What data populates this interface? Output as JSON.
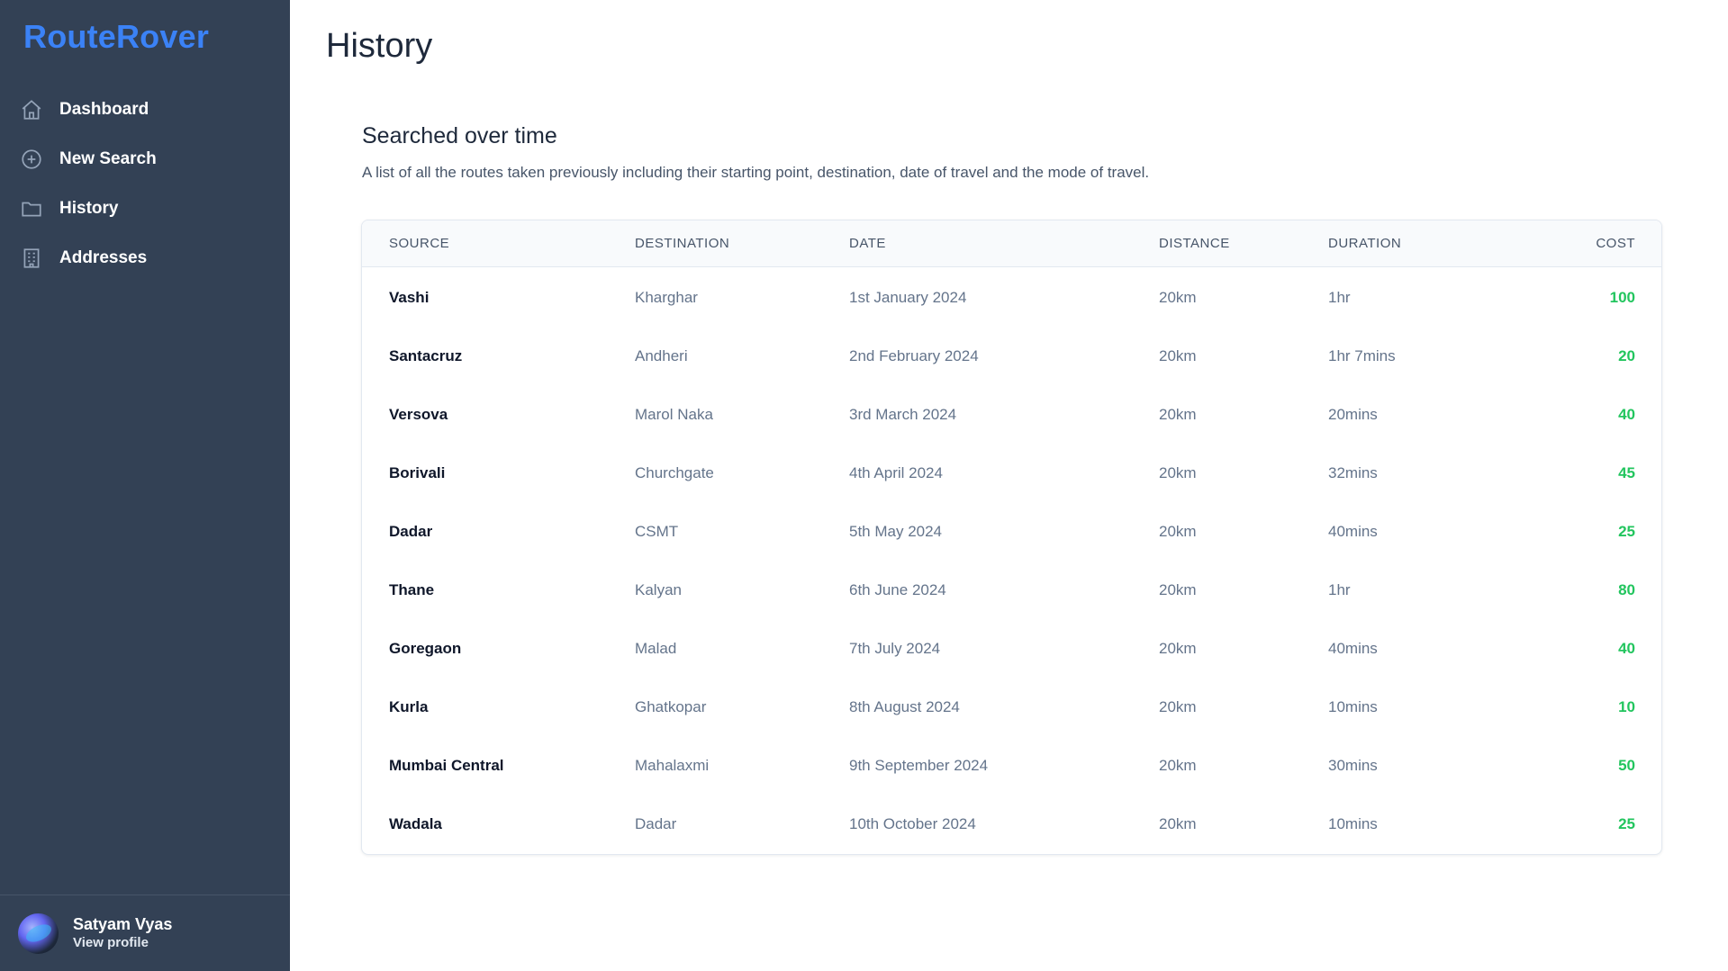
{
  "app": {
    "brand": "RouteRover",
    "brand_color": "#3b82f6"
  },
  "sidebar": {
    "items": [
      {
        "label": "Dashboard",
        "icon": "home-icon"
      },
      {
        "label": "New Search",
        "icon": "plus-circle-icon"
      },
      {
        "label": "History",
        "icon": "folder-icon"
      },
      {
        "label": "Addresses",
        "icon": "building-icon"
      }
    ],
    "profile": {
      "name": "Satyam Vyas",
      "link": "View profile"
    }
  },
  "main": {
    "title": "History",
    "section_title": "Searched over time",
    "section_description": "A list of all the routes taken previously including their starting point, destination, date of travel and the mode of travel.",
    "table": {
      "columns": [
        "SOURCE",
        "DESTINATION",
        "DATE",
        "DISTANCE",
        "DURATION",
        "COST"
      ],
      "rows": [
        [
          "Vashi",
          "Kharghar",
          "1st January 2024",
          "20km",
          "1hr",
          "100"
        ],
        [
          "Santacruz",
          "Andheri",
          "2nd February 2024",
          "20km",
          "1hr 7mins",
          "20"
        ],
        [
          "Versova",
          "Marol Naka",
          "3rd March 2024",
          "20km",
          "20mins",
          "40"
        ],
        [
          "Borivali",
          "Churchgate",
          "4th April 2024",
          "20km",
          "32mins",
          "45"
        ],
        [
          "Dadar",
          "CSMT",
          "5th May 2024",
          "20km",
          "40mins",
          "25"
        ],
        [
          "Thane",
          "Kalyan",
          "6th June 2024",
          "20km",
          "1hr",
          "80"
        ],
        [
          "Goregaon",
          "Malad",
          "7th July 2024",
          "20km",
          "40mins",
          "40"
        ],
        [
          "Kurla",
          "Ghatkopar",
          "8th August 2024",
          "20km",
          "10mins",
          "10"
        ],
        [
          "Mumbai Central",
          "Mahalaxmi",
          "9th September 2024",
          "20km",
          "30mins",
          "50"
        ],
        [
          "Wadala",
          "Dadar",
          "10th October 2024",
          "20km",
          "10mins",
          "25"
        ]
      ]
    },
    "cost_color": "#22c55e"
  }
}
